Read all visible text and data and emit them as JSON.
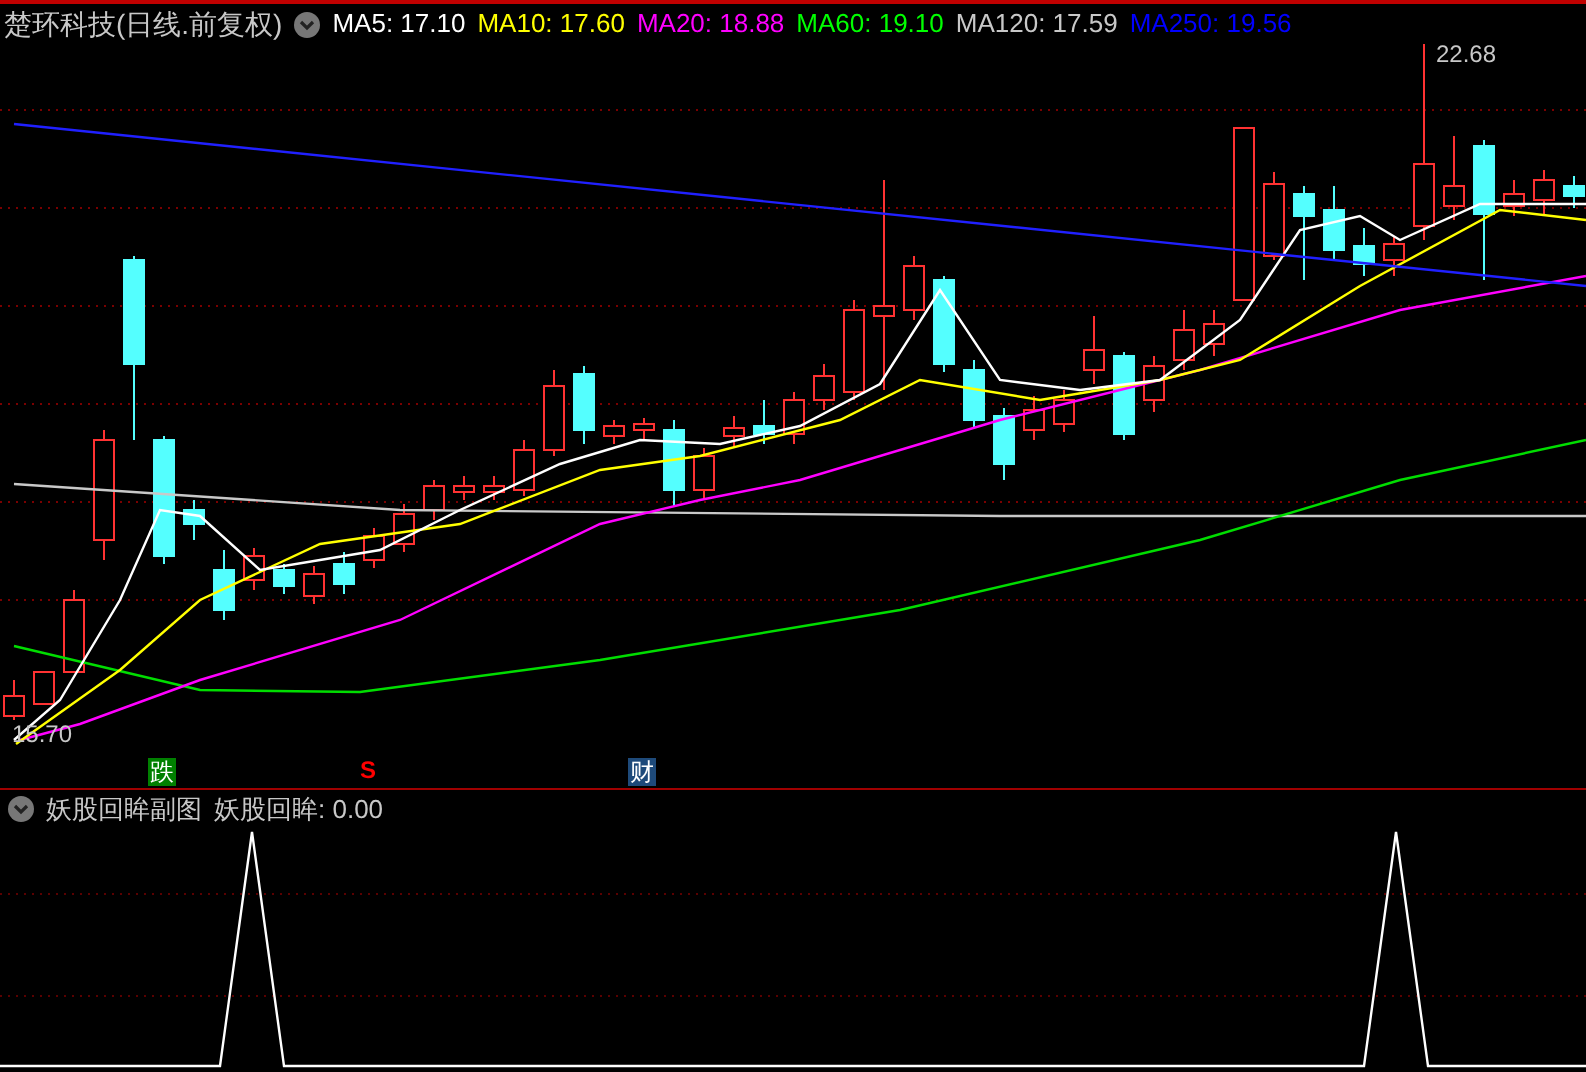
{
  "header": {
    "stock": "楚环科技(日线.前复权)",
    "indicators": [
      {
        "label": "MA5: 17.10",
        "color": "#ffffff"
      },
      {
        "label": "MA10: 17.60",
        "color": "#ffff00"
      },
      {
        "label": "MA20: 18.88",
        "color": "#ff00ff"
      },
      {
        "label": "MA60: 19.10",
        "color": "#00ff00"
      },
      {
        "label": "MA120: 17.59",
        "color": "#c8c8c8"
      },
      {
        "label": "MA250: 19.56",
        "color": "#0000ff"
      }
    ]
  },
  "price_labels": [
    {
      "kind": "high",
      "text": "22.68"
    },
    {
      "kind": "low",
      "text": "15.70"
    }
  ],
  "markers": [
    {
      "kind": "box",
      "text": "跌",
      "color": "#008000"
    },
    {
      "kind": "sell",
      "text": "S",
      "color": "#ff0000"
    },
    {
      "kind": "box",
      "text": "财",
      "color": "#1e4a7a"
    }
  ],
  "sub_panel": {
    "title": "妖股回眸副图",
    "reading": "妖股回眸: 0.00"
  }
}
